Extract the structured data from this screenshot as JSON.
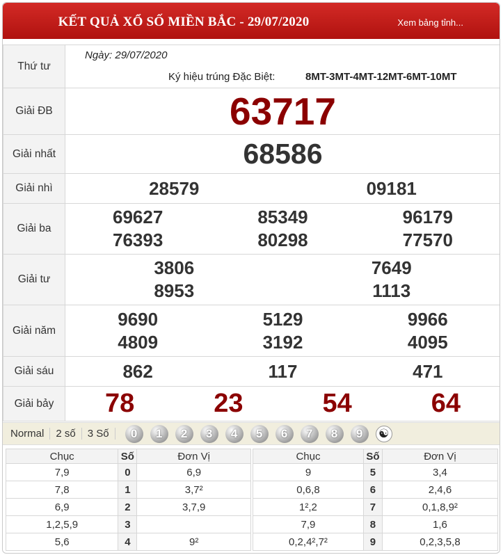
{
  "header": {
    "title": "KẾT QUẢ XỔ SỐ MIỀN BẮC - 29/07/2020",
    "link": "Xem bảng tỉnh..."
  },
  "info": {
    "weekday": "Thứ tư",
    "date": "Ngày: 29/07/2020",
    "symbol_label": "Ký hiệu trúng Đặc Biệt:",
    "symbol_value": "8MT-3MT-4MT-12MT-6MT-10MT"
  },
  "prizes": {
    "db": {
      "label": "Giải ĐB",
      "numbers": [
        "63717"
      ]
    },
    "nhat": {
      "label": "Giải nhất",
      "numbers": [
        "68586"
      ]
    },
    "nhi": {
      "label": "Giải nhì",
      "numbers": [
        "28579",
        "09181"
      ]
    },
    "ba": {
      "label": "Giải ba",
      "numbers": [
        "69627",
        "85349",
        "96179",
        "76393",
        "80298",
        "77570"
      ]
    },
    "tu": {
      "label": "Giải tư",
      "numbers": [
        "3806",
        "7649",
        "8953",
        "1113"
      ]
    },
    "nam": {
      "label": "Giải năm",
      "numbers": [
        "9690",
        "5129",
        "9966",
        "4809",
        "3192",
        "4095"
      ]
    },
    "sau": {
      "label": "Giải sáu",
      "numbers": [
        "862",
        "117",
        "471"
      ]
    },
    "bay": {
      "label": "Giải bảy",
      "numbers": [
        "78",
        "23",
        "54",
        "64"
      ]
    }
  },
  "accent_color": "#8b0000",
  "header_color": "#c41e1a",
  "filters": {
    "tabs": [
      "Normal",
      "2 số",
      "3 Số"
    ],
    "digits": [
      "0",
      "1",
      "2",
      "3",
      "4",
      "5",
      "6",
      "7",
      "8",
      "9"
    ],
    "extra_icon": "yin-yang-icon",
    "extra_glyph": "☯"
  },
  "loto": {
    "headers": {
      "chuc": "Chục",
      "so": "Số",
      "donvi": "Đơn Vị"
    },
    "left": [
      {
        "chuc": "7,9",
        "so": "0",
        "donvi": "6,9"
      },
      {
        "chuc": "7,8",
        "so": "1",
        "donvi": "3,7²"
      },
      {
        "chuc": "6,9",
        "so": "2",
        "donvi": "3,7,9"
      },
      {
        "chuc": "1,2,5,9",
        "so": "3",
        "donvi": ""
      },
      {
        "chuc": "5,6",
        "so": "4",
        "donvi": "9²"
      }
    ],
    "right": [
      {
        "chuc": "9",
        "so": "5",
        "donvi": "3,4"
      },
      {
        "chuc": "0,6,8",
        "so": "6",
        "donvi": "2,4,6"
      },
      {
        "chuc": "1²,2",
        "so": "7",
        "donvi": "0,1,8,9²"
      },
      {
        "chuc": "7,9",
        "so": "8",
        "donvi": "1,6"
      },
      {
        "chuc": "0,2,4²,7²",
        "so": "9",
        "donvi": "0,2,3,5,8"
      }
    ]
  }
}
